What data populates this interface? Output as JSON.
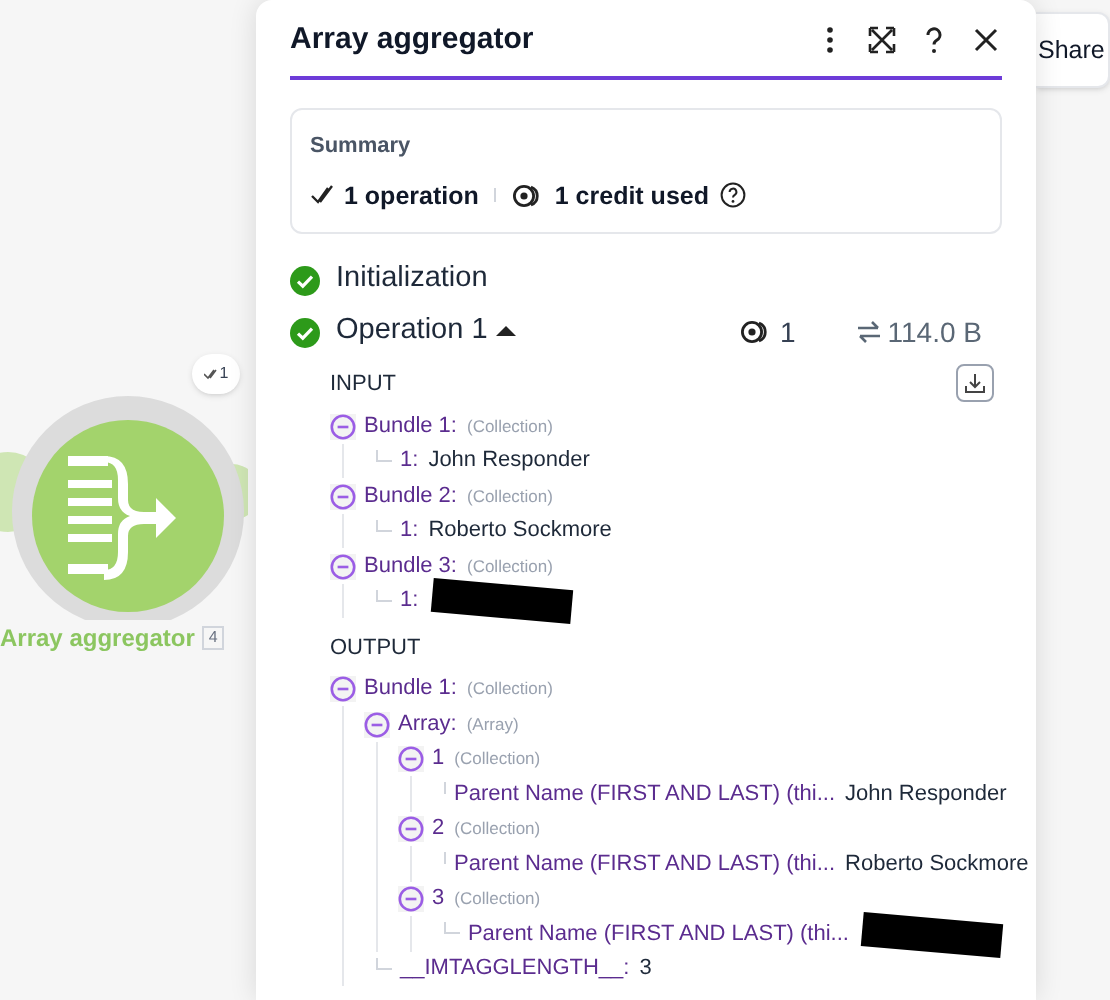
{
  "canvas": {
    "module": {
      "label": "Array aggregator",
      "number": "4",
      "badge": "1"
    },
    "share_button": "Share"
  },
  "panel": {
    "title": "Array aggregator",
    "summary": {
      "heading": "Summary",
      "operations": "1 operation",
      "credits": "1 credit used"
    },
    "steps": [
      {
        "label": "Initialization",
        "done": true
      },
      {
        "label": "Operation 1",
        "done": true,
        "expanded": true,
        "credits": "1",
        "size": "114.0 B"
      }
    ],
    "sections": [
      {
        "heading": "INPUT",
        "download": true,
        "children": [
          {
            "label": "Bundle 1:",
            "type": "(Collection)",
            "expanded": true,
            "children": [
              {
                "label": "1:",
                "value": "John Responder"
              }
            ]
          },
          {
            "label": "Bundle 2:",
            "type": "(Collection)",
            "expanded": true,
            "children": [
              {
                "label": "1:",
                "value": "Roberto Sockmore"
              }
            ]
          },
          {
            "label": "Bundle 3:",
            "type": "(Collection)",
            "expanded": true,
            "children": [
              {
                "label": "1:",
                "redacted": true
              }
            ]
          }
        ]
      },
      {
        "heading": "OUTPUT",
        "children": [
          {
            "label": "Bundle 1:",
            "type": "(Collection)",
            "expanded": true,
            "children": [
              {
                "label": "Array:",
                "type": "(Array)",
                "expanded": true,
                "children": [
                  {
                    "label": "1",
                    "type": "(Collection)",
                    "expanded": true,
                    "children": [
                      {
                        "label": "Parent Name (FIRST AND LAST) (thi...",
                        "value": "John Responder"
                      }
                    ]
                  },
                  {
                    "label": "2",
                    "type": "(Collection)",
                    "expanded": true,
                    "children": [
                      {
                        "label": "Parent Name (FIRST AND LAST) (thi...",
                        "value": "Roberto Sockmore"
                      }
                    ]
                  },
                  {
                    "label": "3",
                    "type": "(Collection)",
                    "expanded": true,
                    "children": [
                      {
                        "label": "Parent Name (FIRST AND LAST) (thi...",
                        "redacted": true
                      }
                    ]
                  }
                ]
              },
              {
                "label": "__IMTAGGLENGTH__:",
                "value": "3"
              }
            ]
          }
        ]
      }
    ]
  }
}
